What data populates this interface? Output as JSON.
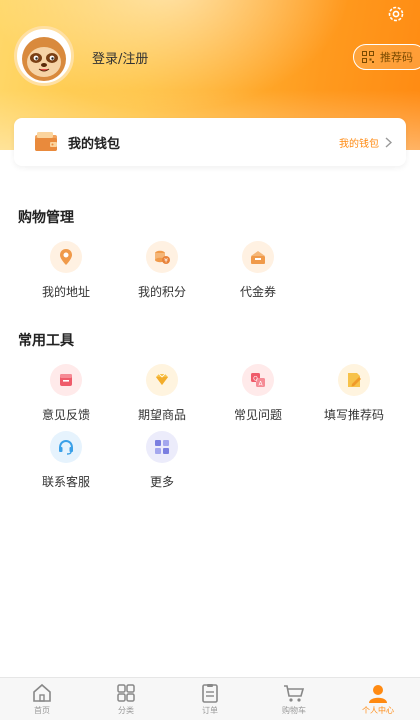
{
  "colors": {
    "accent": "#ff8a12",
    "header_start": "#ffd86a",
    "header_end": "#ff8a12"
  },
  "header": {
    "login_label": "登录/注册",
    "referral_label": "推荐码",
    "settings_icon": "gear-icon",
    "avatar_icon": "sloth-avatar"
  },
  "wallet": {
    "title": "我的钱包",
    "link_label": "我的钱包"
  },
  "shopping": {
    "title": "购物管理",
    "items": [
      {
        "label": "我的地址",
        "icon": "location-icon"
      },
      {
        "label": "我的积分",
        "icon": "points-icon"
      },
      {
        "label": "代金券",
        "icon": "voucher-icon"
      }
    ]
  },
  "tools": {
    "title": "常用工具",
    "items": [
      {
        "label": "意见反馈",
        "icon": "feedback-icon"
      },
      {
        "label": "期望商品",
        "icon": "diamond-icon"
      },
      {
        "label": "常见问题",
        "icon": "faq-icon"
      },
      {
        "label": "填写推荐码",
        "icon": "edit-referral-icon"
      },
      {
        "label": "联系客服",
        "icon": "headset-icon"
      },
      {
        "label": "更多",
        "icon": "more-grid-icon"
      }
    ]
  },
  "tabbar": {
    "items": [
      {
        "label": "首页",
        "icon": "home-icon"
      },
      {
        "label": "分类",
        "icon": "category-icon"
      },
      {
        "label": "订单",
        "icon": "order-icon"
      },
      {
        "label": "购物车",
        "icon": "cart-icon"
      },
      {
        "label": "个人中心",
        "icon": "profile-icon"
      }
    ],
    "active": "个人中心"
  }
}
